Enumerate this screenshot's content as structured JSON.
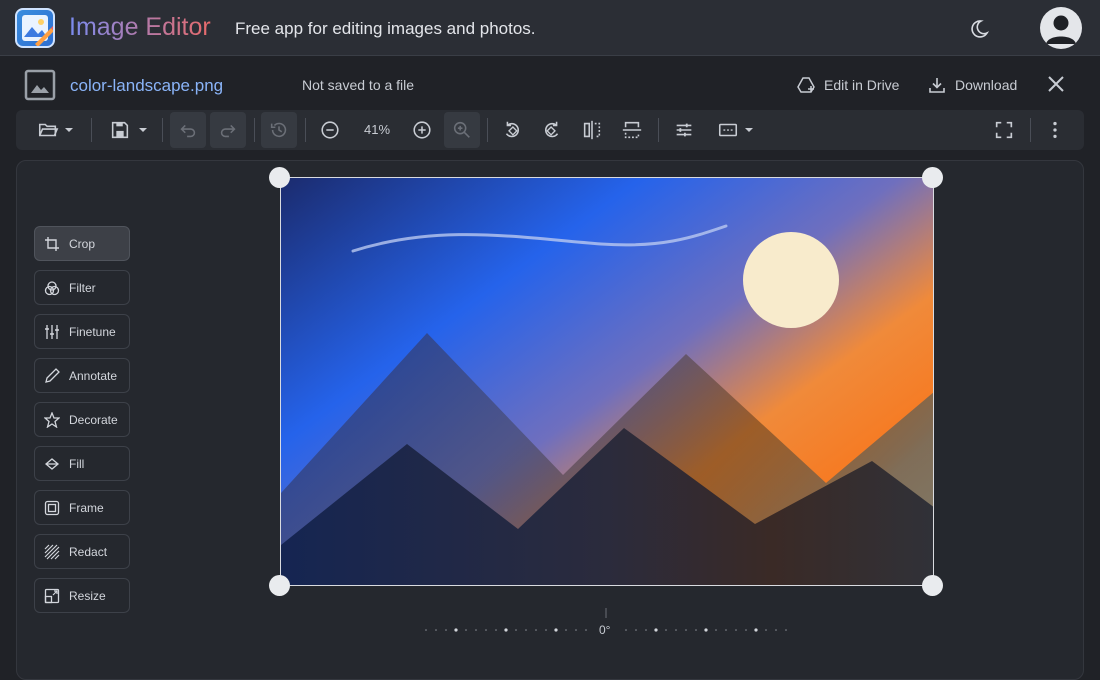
{
  "app": {
    "title": "Image Editor",
    "subtitle": "Free app for editing images and photos."
  },
  "header": {
    "theme_icon": "moon-icon",
    "account_icon": "account-icon"
  },
  "file": {
    "name": "color-landscape.png",
    "status": "Not saved to a file",
    "edit_drive_label": "Edit in Drive",
    "download_label": "Download"
  },
  "toolbar": {
    "zoom": "41%",
    "buttons": [
      "open-folder",
      "save",
      "undo",
      "redo",
      "history",
      "zoom-out",
      "zoom-in",
      "zoom-to-fit",
      "rotate-left",
      "rotate-right",
      "flip-horizontal",
      "flip-vertical",
      "adjust",
      "aspect-ratio",
      "fullscreen",
      "more"
    ],
    "disabled": [
      "undo",
      "redo",
      "history",
      "zoom-to-fit"
    ]
  },
  "tools": [
    {
      "label": "Crop",
      "icon": "crop-icon",
      "active": true
    },
    {
      "label": "Filter",
      "icon": "filter-icon",
      "active": false
    },
    {
      "label": "Finetune",
      "icon": "finetune-icon",
      "active": false
    },
    {
      "label": "Annotate",
      "icon": "pencil-icon",
      "active": false
    },
    {
      "label": "Decorate",
      "icon": "star-icon",
      "active": false
    },
    {
      "label": "Fill",
      "icon": "fill-icon",
      "active": false
    },
    {
      "label": "Frame",
      "icon": "frame-icon",
      "active": false
    },
    {
      "label": "Redact",
      "icon": "redact-icon",
      "active": false
    },
    {
      "label": "Resize",
      "icon": "resize-icon",
      "active": false
    }
  ],
  "rotation": {
    "label": "0°"
  },
  "colors": {
    "accent": "#8ab4f8",
    "background": "#202227",
    "panel": "#2b2e35"
  }
}
